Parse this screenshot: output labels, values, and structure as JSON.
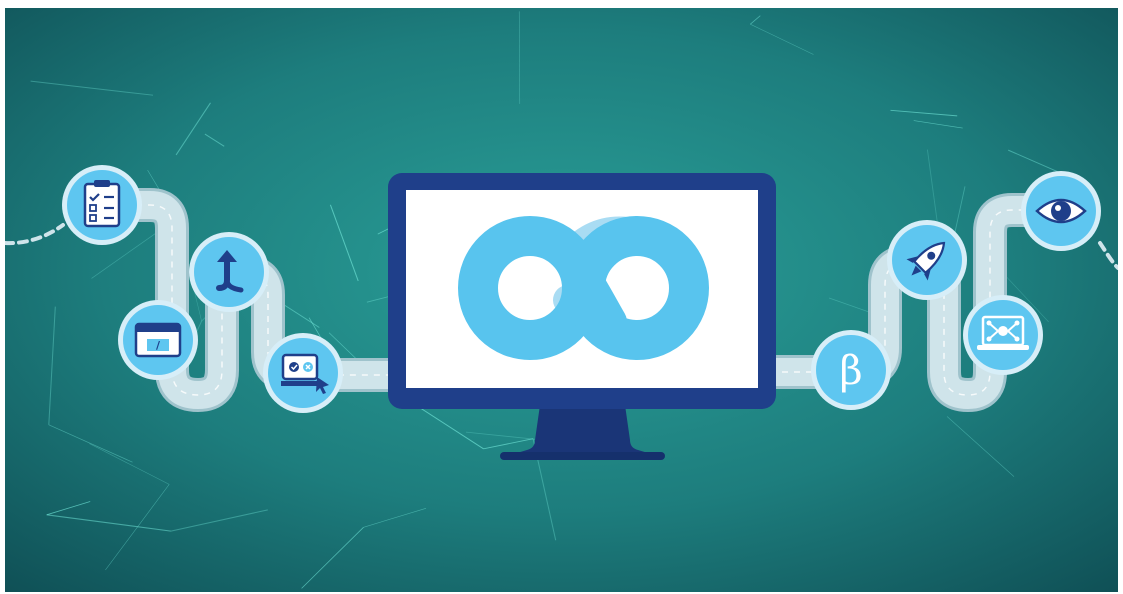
{
  "palette": {
    "bg_inner": "#2a9f98",
    "bg_mid": "#1d7d7d",
    "bg_outer": "#0f4f55",
    "network_line": "#6fe3d6",
    "road": "#cfe4ea",
    "road_edge": "#9fc3cc",
    "badge_fill": "#5ec6f0",
    "badge_ring": "#d7eef8",
    "monitor_frame": "#1f3f8a",
    "monitor_stand": "#1a3577",
    "screen": "#ffffff",
    "infinity": "#58c4ee",
    "infinity_light": "#a9dcf3",
    "icon_dark": "#1f3f8a",
    "icon_white": "#ffffff"
  },
  "icons": {
    "left": [
      "checklist-icon",
      "branch-arrow-icon",
      "code-window-icon",
      "automation-monitor-icon"
    ],
    "right": [
      "eye-icon",
      "rocket-icon",
      "monitor-network-icon",
      "beta-icon"
    ]
  },
  "beta_glyph": "β",
  "code_glyph": "/"
}
